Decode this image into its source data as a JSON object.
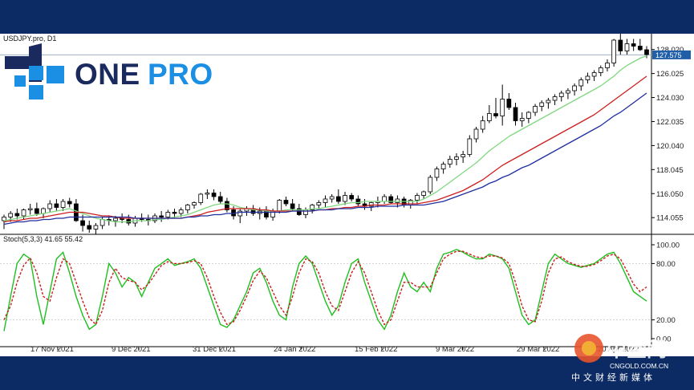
{
  "symbol_label": "USDJPY.pro, D1",
  "stoch_label": "Stoch(5,3,3) 41.65 55.42",
  "logo": {
    "one": "ONE",
    "pro": "PRO"
  },
  "watermark": {
    "big": "中金网",
    "url": "CNGOLD.COM.CN",
    "tagline": "中文财经新媒体"
  },
  "current_price": "127.575",
  "colors": {
    "ma_fast": "#7fd87f",
    "ma_mid": "#cc1f1f",
    "ma_slow": "#1f2fa0",
    "stoch_main": "#1fbf1f",
    "stoch_signal": "#c81e1e",
    "price_line": "#9fb0c2",
    "price_tag": "#1f5fa8",
    "logo_blue": "#1a8fe3",
    "logo_navy": "#1b2a5e"
  },
  "chart_data": [
    {
      "type": "candlestick",
      "title": "USDJPY.pro, D1",
      "x_ticks": [
        "17 Nov 2021",
        "9 Dec 2021",
        "31 Dec 2021",
        "24 Jan 2022",
        "15 Feb 2022",
        "9 Mar 2022",
        "29 Mar 2022",
        "20 Apr 2022"
      ],
      "y_ticks": [
        "128.020",
        "126.025",
        "124.030",
        "122.035",
        "120.040",
        "118.045",
        "116.050",
        "114.055"
      ],
      "ylim": [
        112.8,
        129.2
      ],
      "ohlc": [
        [
          113.8,
          114.3,
          113.1,
          114.1
        ],
        [
          114.1,
          114.6,
          113.7,
          114.4
        ],
        [
          114.4,
          114.8,
          113.9,
          114.2
        ],
        [
          114.2,
          114.8,
          113.9,
          114.7
        ],
        [
          114.7,
          115.2,
          114.3,
          114.8
        ],
        [
          114.8,
          115.3,
          114.2,
          114.4
        ],
        [
          114.4,
          114.9,
          114.0,
          114.8
        ],
        [
          114.8,
          115.5,
          114.5,
          115.2
        ],
        [
          115.2,
          115.6,
          114.6,
          114.9
        ],
        [
          114.9,
          115.6,
          114.6,
          115.4
        ],
        [
          115.4,
          115.7,
          114.9,
          115.2
        ],
        [
          115.2,
          115.6,
          113.7,
          113.8
        ],
        [
          113.8,
          114.3,
          112.9,
          113.4
        ],
        [
          113.4,
          113.8,
          112.8,
          113.1
        ],
        [
          113.1,
          113.6,
          112.7,
          113.4
        ],
        [
          113.4,
          114.1,
          113.1,
          113.9
        ],
        [
          113.9,
          114.2,
          113.4,
          113.8
        ],
        [
          113.8,
          114.2,
          113.3,
          114.0
        ],
        [
          114.0,
          114.4,
          113.6,
          113.9
        ],
        [
          113.9,
          114.3,
          113.4,
          113.6
        ],
        [
          113.6,
          114.2,
          113.3,
          114.0
        ],
        [
          114.0,
          114.4,
          113.7,
          113.9
        ],
        [
          113.9,
          114.3,
          113.4,
          113.8
        ],
        [
          113.8,
          114.4,
          113.6,
          114.2
        ],
        [
          114.2,
          114.6,
          113.7,
          114.1
        ],
        [
          114.1,
          114.7,
          113.9,
          114.5
        ],
        [
          114.5,
          114.8,
          114.0,
          114.4
        ],
        [
          114.4,
          114.9,
          114.1,
          114.7
        ],
        [
          114.7,
          115.2,
          114.4,
          115.1
        ],
        [
          115.1,
          115.4,
          114.8,
          115.3
        ],
        [
          115.3,
          116.1,
          115.1,
          116.0
        ],
        [
          116.0,
          116.4,
          115.6,
          116.1
        ],
        [
          116.1,
          116.4,
          115.5,
          115.8
        ],
        [
          115.8,
          116.2,
          115.2,
          115.4
        ],
        [
          115.4,
          115.7,
          114.5,
          114.7
        ],
        [
          114.7,
          115.0,
          113.9,
          114.2
        ],
        [
          114.2,
          114.8,
          113.6,
          114.6
        ],
        [
          114.6,
          115.0,
          114.2,
          114.8
        ],
        [
          114.8,
          115.1,
          114.2,
          114.4
        ],
        [
          114.4,
          114.9,
          113.9,
          114.6
        ],
        [
          114.6,
          115.0,
          113.9,
          114.1
        ],
        [
          114.1,
          114.8,
          113.8,
          114.6
        ],
        [
          114.6,
          115.6,
          114.4,
          115.5
        ],
        [
          115.5,
          115.8,
          115.0,
          115.2
        ],
        [
          115.2,
          115.6,
          114.6,
          114.8
        ],
        [
          114.8,
          115.2,
          114.2,
          114.3
        ],
        [
          114.3,
          114.9,
          114.0,
          114.7
        ],
        [
          114.7,
          115.2,
          114.4,
          115.1
        ],
        [
          115.1,
          115.5,
          114.8,
          115.3
        ],
        [
          115.3,
          115.9,
          114.9,
          115.6
        ],
        [
          115.6,
          116.0,
          115.3,
          115.8
        ],
        [
          115.8,
          116.4,
          115.2,
          115.4
        ],
        [
          115.4,
          116.2,
          115.1,
          115.9
        ],
        [
          115.9,
          116.1,
          115.4,
          115.6
        ],
        [
          115.6,
          115.9,
          115.0,
          115.2
        ],
        [
          115.2,
          115.6,
          114.7,
          115.0
        ],
        [
          115.0,
          115.4,
          114.6,
          115.3
        ],
        [
          115.3,
          115.8,
          114.9,
          115.4
        ],
        [
          115.4,
          116.0,
          115.2,
          115.8
        ],
        [
          115.8,
          116.0,
          115.2,
          115.3
        ],
        [
          115.3,
          115.9,
          114.9,
          115.6
        ],
        [
          115.6,
          115.8,
          114.9,
          115.1
        ],
        [
          115.1,
          115.6,
          114.8,
          115.5
        ],
        [
          115.5,
          116.1,
          115.2,
          115.9
        ],
        [
          115.9,
          116.3,
          115.6,
          116.2
        ],
        [
          116.2,
          117.6,
          116.0,
          117.4
        ],
        [
          117.4,
          118.3,
          117.1,
          118.1
        ],
        [
          118.1,
          118.7,
          117.7,
          118.5
        ],
        [
          118.5,
          119.2,
          118.2,
          118.9
        ],
        [
          118.9,
          119.4,
          118.4,
          119.1
        ],
        [
          119.1,
          119.6,
          118.6,
          119.3
        ],
        [
          119.3,
          120.9,
          119.1,
          120.6
        ],
        [
          120.6,
          121.6,
          120.3,
          121.4
        ],
        [
          121.4,
          122.5,
          121.1,
          122.1
        ],
        [
          122.1,
          123.4,
          121.9,
          122.7
        ],
        [
          122.7,
          124.0,
          122.3,
          122.5
        ],
        [
          122.5,
          125.1,
          121.7,
          123.9
        ],
        [
          123.9,
          124.4,
          123.0,
          123.2
        ],
        [
          123.2,
          123.6,
          121.7,
          122.1
        ],
        [
          122.1,
          122.8,
          121.6,
          122.3
        ],
        [
          122.3,
          122.9,
          121.9,
          122.8
        ],
        [
          122.8,
          123.5,
          122.5,
          123.3
        ],
        [
          123.3,
          123.8,
          122.9,
          123.6
        ],
        [
          123.6,
          124.0,
          123.1,
          123.8
        ],
        [
          123.8,
          124.3,
          123.4,
          124.1
        ],
        [
          124.1,
          124.6,
          123.7,
          124.4
        ],
        [
          124.4,
          124.8,
          123.9,
          124.6
        ],
        [
          124.6,
          125.2,
          124.2,
          125.0
        ],
        [
          125.0,
          125.7,
          124.6,
          125.5
        ],
        [
          125.5,
          126.1,
          125.2,
          125.8
        ],
        [
          125.8,
          126.3,
          125.4,
          126.1
        ],
        [
          126.1,
          126.7,
          125.8,
          126.5
        ],
        [
          126.5,
          127.2,
          126.2,
          126.9
        ],
        [
          126.9,
          128.9,
          126.6,
          128.8
        ],
        [
          128.8,
          129.4,
          127.6,
          127.9
        ],
        [
          127.9,
          128.9,
          127.6,
          128.5
        ],
        [
          128.5,
          128.9,
          127.9,
          128.3
        ],
        [
          128.3,
          128.9,
          127.9,
          128.0
        ],
        [
          128.0,
          128.3,
          127.3,
          127.6
        ]
      ],
      "series": [
        {
          "name": "MA fast",
          "values": [
            113.8,
            113.9,
            114.0,
            114.1,
            114.2,
            114.3,
            114.4,
            114.5,
            114.6,
            114.7,
            114.8,
            114.6,
            114.4,
            114.2,
            114.0,
            113.9,
            113.8,
            113.7,
            113.7,
            113.7,
            113.8,
            113.8,
            113.8,
            113.9,
            113.9,
            114.0,
            114.1,
            114.2,
            114.3,
            114.5,
            114.7,
            114.9,
            115.1,
            115.2,
            115.2,
            115.1,
            114.9,
            114.8,
            114.7,
            114.7,
            114.6,
            114.6,
            114.6,
            114.7,
            114.7,
            114.7,
            114.7,
            114.8,
            114.8,
            114.9,
            115.0,
            115.1,
            115.2,
            115.3,
            115.3,
            115.4,
            115.4,
            115.4,
            115.4,
            115.4,
            115.4,
            115.4,
            115.4,
            115.4,
            115.6,
            115.9,
            116.2,
            116.6,
            117.0,
            117.4,
            117.8,
            118.2,
            118.6,
            119.1,
            119.6,
            120.0,
            120.4,
            120.8,
            121.1,
            121.4,
            121.7,
            122.0,
            122.3,
            122.6,
            122.9,
            123.2,
            123.5,
            123.8,
            124.1,
            124.4,
            124.7,
            125.0,
            125.4,
            125.8,
            126.3,
            126.7,
            127.0,
            127.3,
            127.5
          ]
        },
        {
          "name": "MA mid",
          "values": [
            113.7,
            113.8,
            113.8,
            113.9,
            114.0,
            114.0,
            114.1,
            114.2,
            114.3,
            114.4,
            114.5,
            114.5,
            114.5,
            114.4,
            114.3,
            114.2,
            114.2,
            114.1,
            114.0,
            114.0,
            114.0,
            114.0,
            114.0,
            114.0,
            114.0,
            114.0,
            114.0,
            114.0,
            114.1,
            114.2,
            114.3,
            114.5,
            114.6,
            114.7,
            114.8,
            114.8,
            114.8,
            114.8,
            114.8,
            114.7,
            114.7,
            114.6,
            114.6,
            114.6,
            114.6,
            114.6,
            114.6,
            114.6,
            114.7,
            114.7,
            114.8,
            114.8,
            114.9,
            114.9,
            115.0,
            115.0,
            115.1,
            115.1,
            115.1,
            115.2,
            115.2,
            115.2,
            115.2,
            115.2,
            115.3,
            115.4,
            115.5,
            115.7,
            115.9,
            116.1,
            116.3,
            116.6,
            116.9,
            117.2,
            117.6,
            118.0,
            118.4,
            118.7,
            119.0,
            119.3,
            119.6,
            119.9,
            120.2,
            120.5,
            120.8,
            121.1,
            121.4,
            121.7,
            122.0,
            122.3,
            122.6,
            123.0,
            123.4,
            123.8,
            124.2,
            124.6,
            125.0,
            125.4,
            125.8
          ]
        },
        {
          "name": "MA slow",
          "values": [
            113.5,
            113.6,
            113.7,
            113.7,
            113.8,
            113.8,
            113.9,
            113.9,
            114.0,
            114.0,
            114.1,
            114.1,
            114.1,
            114.1,
            114.1,
            114.1,
            114.1,
            114.1,
            114.1,
            114.1,
            114.0,
            114.0,
            114.0,
            114.0,
            114.0,
            114.0,
            114.0,
            114.0,
            114.1,
            114.1,
            114.2,
            114.2,
            114.3,
            114.3,
            114.4,
            114.4,
            114.5,
            114.5,
            114.5,
            114.5,
            114.5,
            114.5,
            114.5,
            114.5,
            114.6,
            114.6,
            114.6,
            114.6,
            114.7,
            114.7,
            114.7,
            114.8,
            114.8,
            114.8,
            114.9,
            114.9,
            114.9,
            115.0,
            115.0,
            115.0,
            115.0,
            115.1,
            115.1,
            115.1,
            115.1,
            115.2,
            115.3,
            115.4,
            115.6,
            115.8,
            116.0,
            116.2,
            116.4,
            116.6,
            116.9,
            117.1,
            117.4,
            117.6,
            117.9,
            118.2,
            118.4,
            118.7,
            119.0,
            119.3,
            119.6,
            119.9,
            120.2,
            120.5,
            120.8,
            121.1,
            121.4,
            121.7,
            122.1,
            122.5,
            122.8,
            123.2,
            123.6,
            124.0,
            124.4
          ]
        }
      ]
    },
    {
      "type": "line",
      "title": "Stoch(5,3,3) 41.65 55.42",
      "y_ticks": [
        "100.00",
        "80.00",
        "20.00",
        "0.00"
      ],
      "ylim": [
        0,
        100
      ],
      "series": [
        {
          "name": "Stoch main",
          "values": [
            8,
            45,
            80,
            90,
            85,
            45,
            15,
            50,
            85,
            92,
            70,
            45,
            25,
            10,
            15,
            45,
            80,
            70,
            55,
            65,
            60,
            45,
            60,
            75,
            80,
            85,
            78,
            80,
            82,
            85,
            75,
            55,
            35,
            15,
            12,
            20,
            35,
            50,
            70,
            75,
            60,
            40,
            25,
            20,
            55,
            80,
            88,
            80,
            60,
            40,
            25,
            35,
            60,
            80,
            85,
            60,
            40,
            20,
            10,
            25,
            50,
            70,
            55,
            50,
            60,
            50,
            75,
            90,
            92,
            95,
            92,
            88,
            85,
            85,
            90,
            88,
            85,
            75,
            50,
            25,
            15,
            20,
            50,
            80,
            90,
            85,
            80,
            78,
            76,
            78,
            80,
            85,
            90,
            92,
            80,
            65,
            50,
            45,
            40
          ]
        },
        {
          "name": "Stoch signal",
          "values": [
            20,
            35,
            60,
            78,
            86,
            70,
            45,
            40,
            65,
            85,
            80,
            60,
            40,
            22,
            15,
            30,
            60,
            75,
            65,
            62,
            60,
            52,
            58,
            68,
            78,
            82,
            80,
            80,
            81,
            83,
            80,
            65,
            45,
            28,
            15,
            18,
            30,
            45,
            62,
            72,
            65,
            50,
            35,
            25,
            45,
            70,
            85,
            82,
            70,
            50,
            35,
            30,
            50,
            70,
            82,
            70,
            50,
            30,
            15,
            20,
            40,
            60,
            60,
            55,
            55,
            55,
            70,
            85,
            90,
            93,
            93,
            90,
            87,
            86,
            88,
            88,
            86,
            80,
            60,
            35,
            20,
            18,
            40,
            70,
            85,
            87,
            82,
            79,
            77,
            77,
            79,
            83,
            88,
            90,
            85,
            72,
            58,
            50,
            55
          ]
        }
      ]
    }
  ]
}
